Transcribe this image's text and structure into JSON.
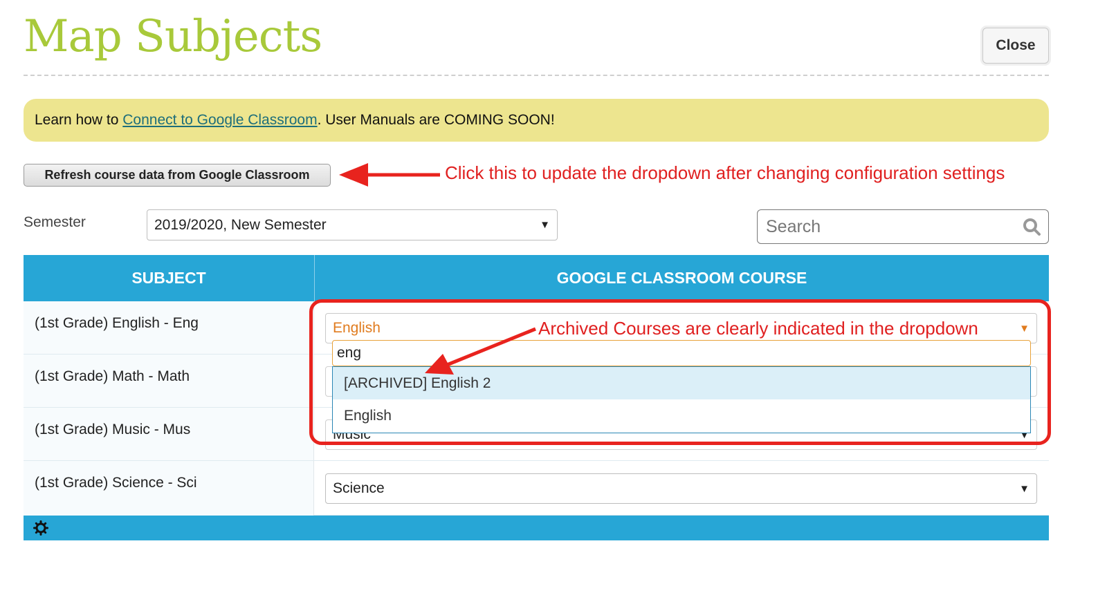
{
  "header": {
    "title": "Map Subjects",
    "close_label": "Close"
  },
  "banner": {
    "prefix": "Learn how to ",
    "link": "Connect to Google Classroom",
    "suffix": ". User Manuals are COMING SOON!"
  },
  "refresh_label": "Refresh course data from Google Classroom",
  "annotations": {
    "refresh_note": "Click this to update the dropdown after changing configuration settings",
    "archived_note": "Archived Courses are clearly indicated in the dropdown"
  },
  "semester": {
    "label": "Semester",
    "value": "2019/2020, New Semester"
  },
  "search": {
    "placeholder": "Search"
  },
  "table": {
    "headers": [
      "SUBJECT",
      "GOOGLE CLASSROOM COURSE"
    ],
    "rows": [
      {
        "subject": "(1st Grade) English - Eng",
        "course": "English"
      },
      {
        "subject": "(1st Grade) Math - Math",
        "course": ""
      },
      {
        "subject": "(1st Grade) Music - Mus",
        "course": "Music"
      },
      {
        "subject": "(1st Grade) Science - Sci",
        "course": "Science"
      }
    ]
  },
  "dropdown": {
    "search_value": "eng",
    "options": [
      "[ARCHIVED] English 2",
      "English"
    ]
  },
  "colors": {
    "title": "#a8c93a",
    "banner": "#ede58f",
    "header_blue": "#27a6d6",
    "annotation_red": "#e02020",
    "active_select": "#e07b1e"
  }
}
